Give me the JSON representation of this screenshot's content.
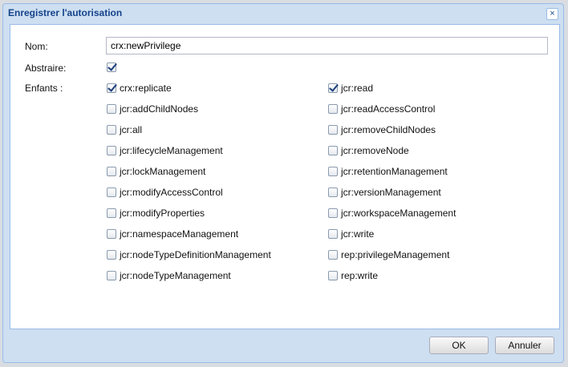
{
  "dialog": {
    "title": "Enregistrer l'autorisation",
    "close": "×"
  },
  "form": {
    "name_label": "Nom:",
    "name_value": "crx:newPrivilege",
    "abstract_label": "Abstraire:",
    "abstract_checked": true,
    "children_label": "Enfants :"
  },
  "children": [
    {
      "label": "crx:replicate",
      "checked": true
    },
    {
      "label": "jcr:read",
      "checked": true
    },
    {
      "label": "jcr:addChildNodes",
      "checked": false
    },
    {
      "label": "jcr:readAccessControl",
      "checked": false
    },
    {
      "label": "jcr:all",
      "checked": false
    },
    {
      "label": "jcr:removeChildNodes",
      "checked": false
    },
    {
      "label": "jcr:lifecycleManagement",
      "checked": false
    },
    {
      "label": "jcr:removeNode",
      "checked": false
    },
    {
      "label": "jcr:lockManagement",
      "checked": false
    },
    {
      "label": "jcr:retentionManagement",
      "checked": false
    },
    {
      "label": "jcr:modifyAccessControl",
      "checked": false
    },
    {
      "label": "jcr:versionManagement",
      "checked": false
    },
    {
      "label": "jcr:modifyProperties",
      "checked": false
    },
    {
      "label": "jcr:workspaceManagement",
      "checked": false
    },
    {
      "label": "jcr:namespaceManagement",
      "checked": false
    },
    {
      "label": "jcr:write",
      "checked": false
    },
    {
      "label": "jcr:nodeTypeDefinitionManagement",
      "checked": false
    },
    {
      "label": "rep:privilegeManagement",
      "checked": false
    },
    {
      "label": "jcr:nodeTypeManagement",
      "checked": false
    },
    {
      "label": "rep:write",
      "checked": false
    }
  ],
  "buttons": {
    "ok": "OK",
    "cancel": "Annuler"
  }
}
